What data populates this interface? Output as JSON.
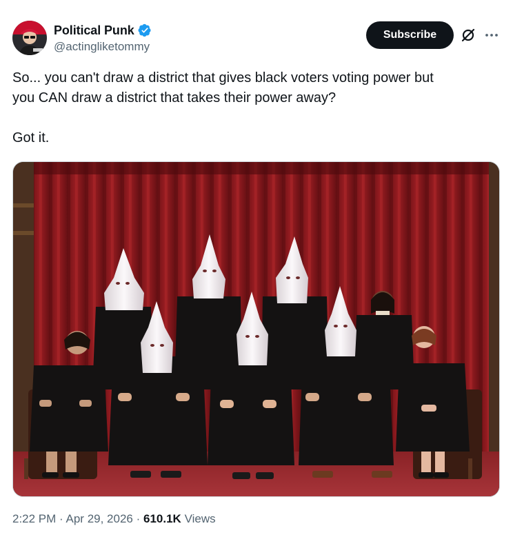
{
  "author": {
    "display_name": "Political Punk",
    "handle": "@actingliketommy",
    "verified": true
  },
  "header": {
    "subscribe_label": "Subscribe",
    "grok_icon": "grok-icon",
    "more_icon": "more-horizontal-icon"
  },
  "tweet": {
    "line1": "So... you can't draw a district that gives black voters voting power but",
    "line2": "you CAN draw a district that takes their power away?",
    "line3": "Got it."
  },
  "meta": {
    "time": "2:22 PM",
    "date": "Apr 29, 2026",
    "separator": "·",
    "views_count": "610.1K",
    "views_label": "Views"
  },
  "colors": {
    "text": "#0f1419",
    "secondary": "#536471",
    "verified_blue": "#1d9bf0",
    "subscribe_bg": "#0f1419",
    "curtain": "#8e1a1f",
    "robe": "#141212",
    "hood": "#f4f1f3",
    "carpet": "#9c2c30"
  }
}
